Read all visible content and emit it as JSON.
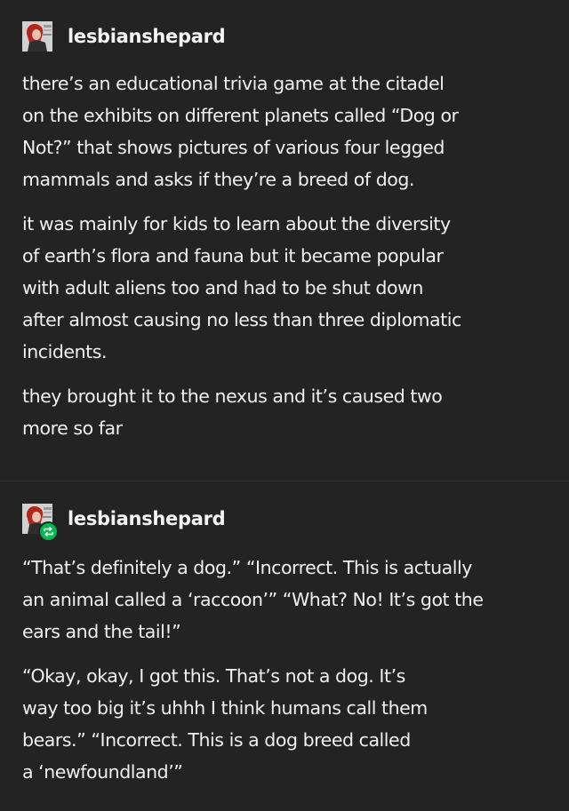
{
  "posts": [
    {
      "username": "lesbianshepard",
      "is_reblog": false,
      "avatar_icon": "avatar-image-icon",
      "paragraphs": [
        "there’s an educational trivia game at the citadel\non the exhibits on different planets called “Dog or\nNot?” that shows  pictures of various four legged\nmammals  and asks if they’re a breed of dog.",
        "it was mainly for kids to learn about the diversity\nof earth’s flora and fauna but it became popular\nwith adult aliens too and had to be shut down\nafter almost causing no less than three diplomatic\nincidents.",
        "they brought it to the nexus and it’s caused two\nmore so far"
      ]
    },
    {
      "username": "lesbianshepard",
      "is_reblog": true,
      "avatar_icon": "avatar-image-icon",
      "badge_icon": "reblog-icon",
      "badge_color": "#00b84c",
      "paragraphs": [
        "“That’s definitely a dog.” “Incorrect. This is actually\nan animal called a ‘raccoon’” “What? No! It’s got the\nears and the tail!”",
        "“Okay, okay, I got this. That’s not a dog. It’s\nway too big it’s uhhh I think humans call them\nbears.” “Incorrect. This is a dog breed called\na ‘newfoundland’”"
      ]
    }
  ],
  "colors": {
    "background": "#232323",
    "text": "#f0f0f0",
    "reblog_badge": "#00b84c"
  }
}
